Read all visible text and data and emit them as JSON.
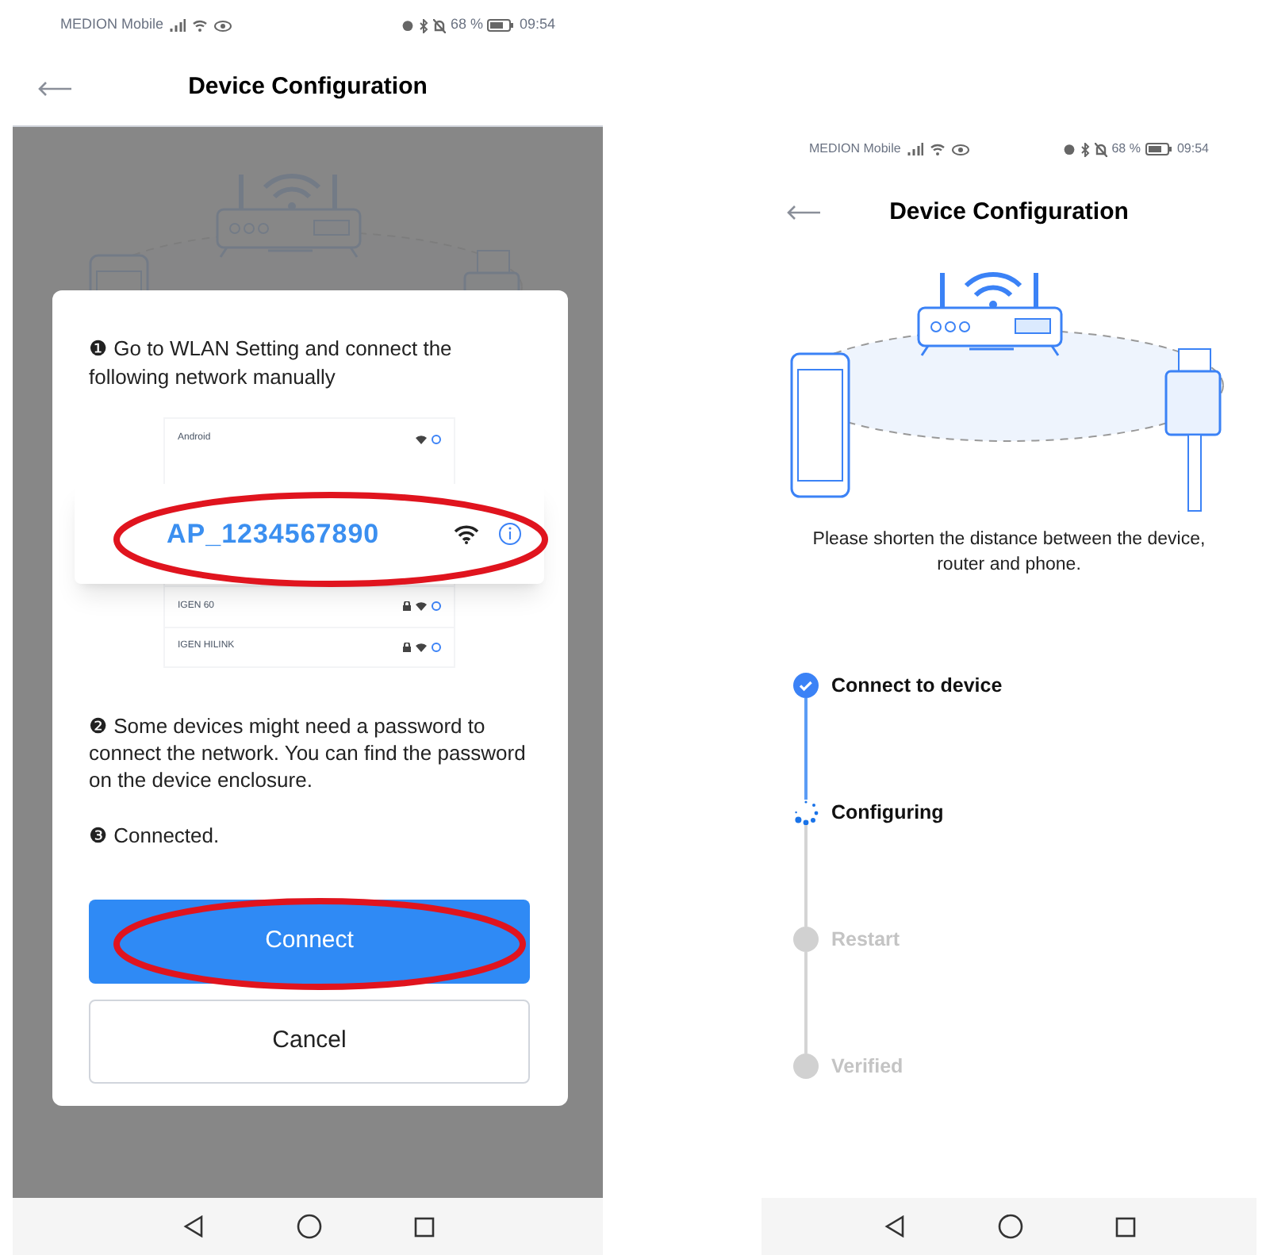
{
  "left_screen": {
    "status_bar": {
      "carrier": "MEDION Mobile",
      "battery": "68 %",
      "time": "09:54"
    },
    "header": {
      "title": "Device Configuration"
    },
    "dialog": {
      "step_1": "❶ Go to WLAN Setting and connect the following network manually",
      "network_list": [
        {
          "name": "Android",
          "locked": false
        },
        {
          "name": "IGEN 60",
          "locked": true
        },
        {
          "name": "IGEN HILINK",
          "locked": true
        }
      ],
      "highlighted_network": "AP_1234567890",
      "step_2": "❷ Some devices might need a password to connect the network. You can find the password on the device enclosure.",
      "step_3": "❸ Connected.",
      "buttons": [
        {
          "label": "Connect",
          "kind": "primary"
        },
        {
          "label": "Cancel",
          "kind": "secondary"
        }
      ]
    }
  },
  "right_screen": {
    "status_bar": {
      "carrier": "MEDION Mobile",
      "battery": "68 %",
      "time": "09:54"
    },
    "header": {
      "title": "Device Configuration"
    },
    "hint": "Please shorten the distance between the device, router and phone.",
    "steps": [
      {
        "label": "Connect to device",
        "completed": true,
        "current": false
      },
      {
        "label": "Configuring",
        "completed": false,
        "current": true
      },
      {
        "label": "Restart",
        "completed": false,
        "current": false
      },
      {
        "label": "Verified",
        "completed": false,
        "current": false
      }
    ]
  }
}
